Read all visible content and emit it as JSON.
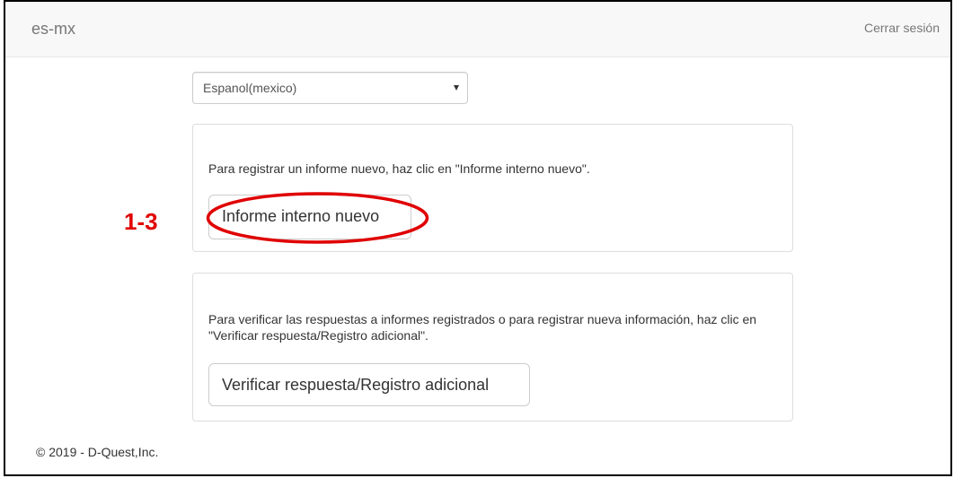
{
  "navbar": {
    "brand": "es-mx",
    "logout": "Cerrar sesión"
  },
  "language_select": {
    "selected": "Espanol(mexico)"
  },
  "panels": [
    {
      "instruction": "Para registrar un informe nuevo, haz clic en \"Informe interno nuevo\".",
      "button": "Informe interno nuevo"
    },
    {
      "instruction": "Para verificar las respuestas a informes registrados o para registrar nueva información, haz clic en \"Verificar respuesta/Registro adicional\".",
      "button": "Verificar respuesta/Registro adicional"
    }
  ],
  "annotation": {
    "label": "1-3",
    "color": "#e00000"
  },
  "footer": {
    "copyright": "© 2019 - D-Quest,Inc."
  },
  "colors": {
    "navbar_bg": "#f8f8f8",
    "border": "#dddddd",
    "text": "#333333",
    "muted": "#777777"
  }
}
